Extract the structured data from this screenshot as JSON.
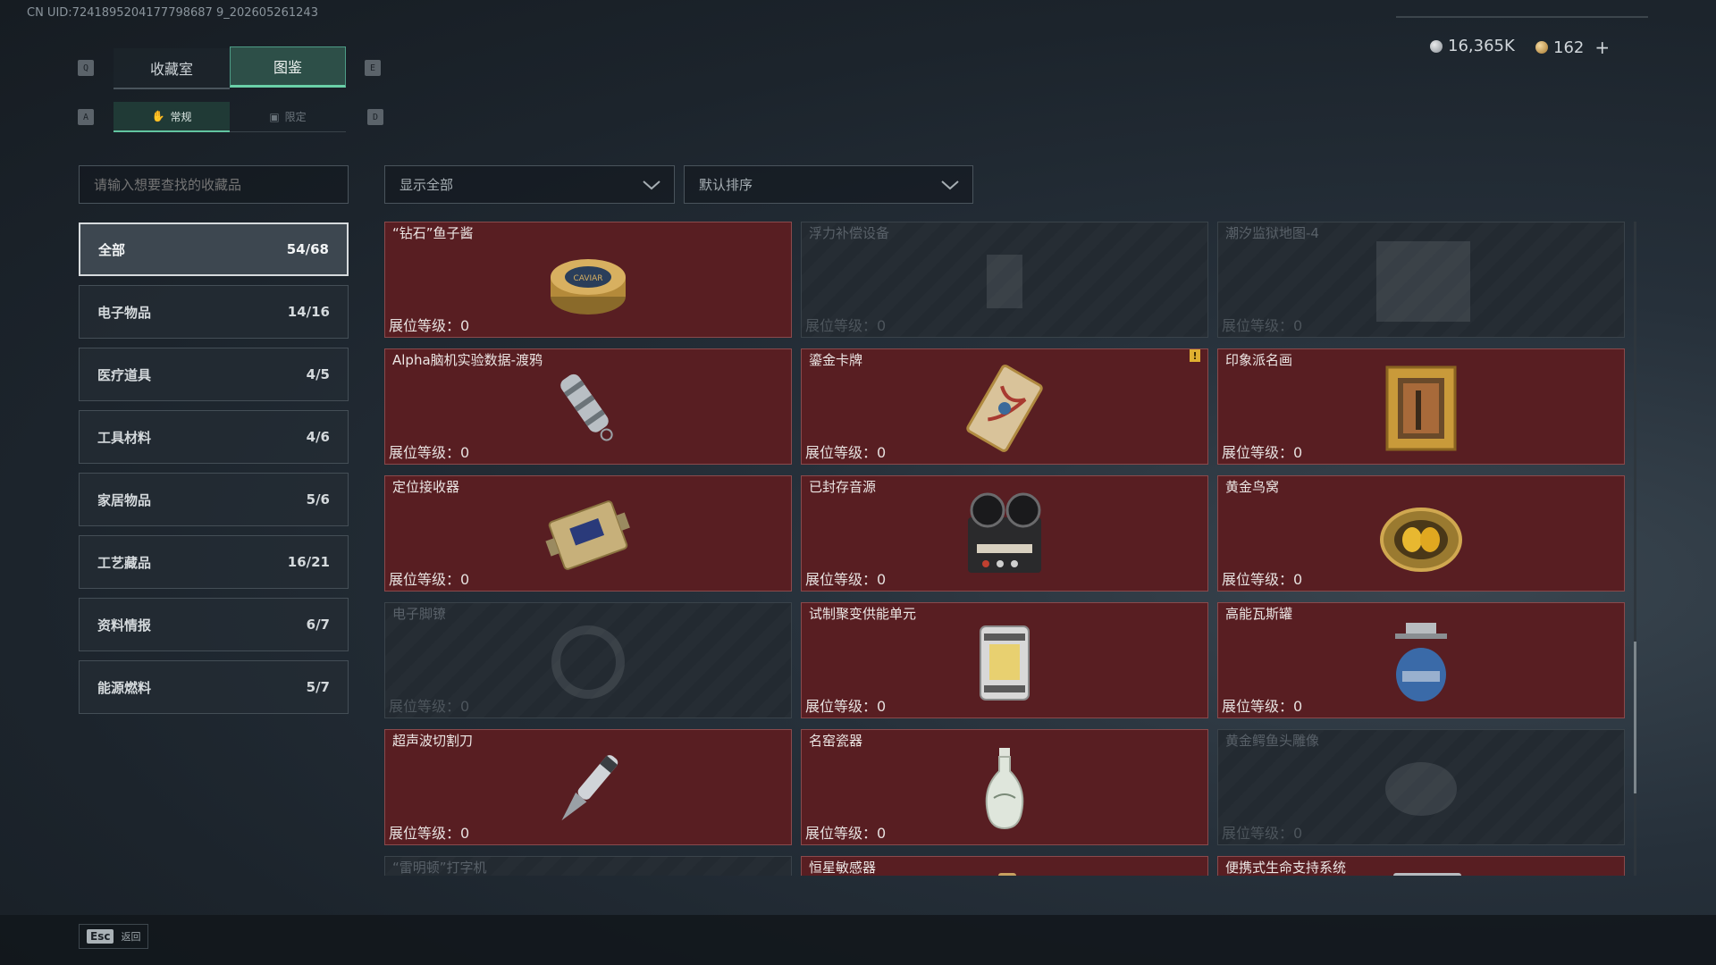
{
  "uid": "CN UID:7241895204177798687 9_202605261243",
  "keys": {
    "q": "Q",
    "e": "E",
    "a": "A",
    "d": "D"
  },
  "tabs": [
    {
      "label": "收藏室",
      "active": false
    },
    {
      "label": "图鉴",
      "active": true
    }
  ],
  "subtabs": [
    {
      "label": "常规",
      "active": true
    },
    {
      "label": "限定",
      "active": false
    }
  ],
  "currency": {
    "silver": "16,365K",
    "gold": "162",
    "plus": "+"
  },
  "search": {
    "placeholder": "请输入想要查找的收藏品"
  },
  "filter": {
    "value": "显示全部"
  },
  "sort": {
    "value": "默认排序"
  },
  "categories": [
    {
      "label": "全部",
      "count": "54/68",
      "active": true
    },
    {
      "label": "电子物品",
      "count": "14/16"
    },
    {
      "label": "医疗道具",
      "count": "4/5"
    },
    {
      "label": "工具材料",
      "count": "4/6"
    },
    {
      "label": "家居物品",
      "count": "5/6"
    },
    {
      "label": "工艺藏品",
      "count": "16/21"
    },
    {
      "label": "资料情报",
      "count": "6/7"
    },
    {
      "label": "能源燃料",
      "count": "5/7"
    }
  ],
  "items": [
    {
      "name": "“钻石”鱼子酱",
      "level": "展位等级：0",
      "locked": false,
      "icon": "caviar-tin-icon"
    },
    {
      "name": "浮力补偿设备",
      "level": "展位等级：0",
      "locked": true,
      "icon": "buoyancy-device-icon"
    },
    {
      "name": "潮汐监狱地图-4",
      "level": "展位等级：0",
      "locked": true,
      "icon": "map-icon"
    },
    {
      "name": "Alpha脑机实验数据-渡鸦",
      "level": "展位等级：0",
      "locked": false,
      "icon": "data-capsule-icon"
    },
    {
      "name": "鎏金卡牌",
      "level": "展位等级：0",
      "locked": false,
      "icon": "gold-card-icon",
      "alert": "!"
    },
    {
      "name": "印象派名画",
      "level": "展位等级：0",
      "locked": false,
      "icon": "painting-icon"
    },
    {
      "name": "定位接收器",
      "level": "展位等级：0",
      "locked": false,
      "icon": "receiver-icon"
    },
    {
      "name": "已封存音源",
      "level": "展位等级：0",
      "locked": false,
      "icon": "reel-recorder-icon"
    },
    {
      "name": "黄金鸟窝",
      "level": "展位等级：0",
      "locked": false,
      "icon": "golden-nest-icon"
    },
    {
      "name": "电子脚镣",
      "level": "展位等级：0",
      "locked": true,
      "icon": "ankle-monitor-icon"
    },
    {
      "name": "试制聚变供能单元",
      "level": "展位等级：0",
      "locked": false,
      "icon": "fusion-cell-icon"
    },
    {
      "name": "高能瓦斯罐",
      "level": "展位等级：0",
      "locked": false,
      "icon": "gas-canister-icon"
    },
    {
      "name": "超声波切割刀",
      "level": "展位等级：0",
      "locked": false,
      "icon": "ultrasonic-knife-icon"
    },
    {
      "name": "名窑瓷器",
      "level": "展位等级：0",
      "locked": false,
      "icon": "porcelain-vase-icon"
    },
    {
      "name": "黄金鳄鱼头雕像",
      "level": "展位等级：0",
      "locked": true,
      "icon": "croc-statue-icon"
    },
    {
      "name": "“雷明顿”打字机",
      "level": "",
      "locked": true,
      "icon": "typewriter-icon"
    },
    {
      "name": "恒星敏感器",
      "level": "",
      "locked": false,
      "icon": "star-sensor-icon"
    },
    {
      "name": "便携式生命支持系统",
      "level": "",
      "locked": false,
      "icon": "life-support-icon"
    }
  ],
  "footer": {
    "esc_key": "Esc",
    "esc_label": "返回"
  }
}
